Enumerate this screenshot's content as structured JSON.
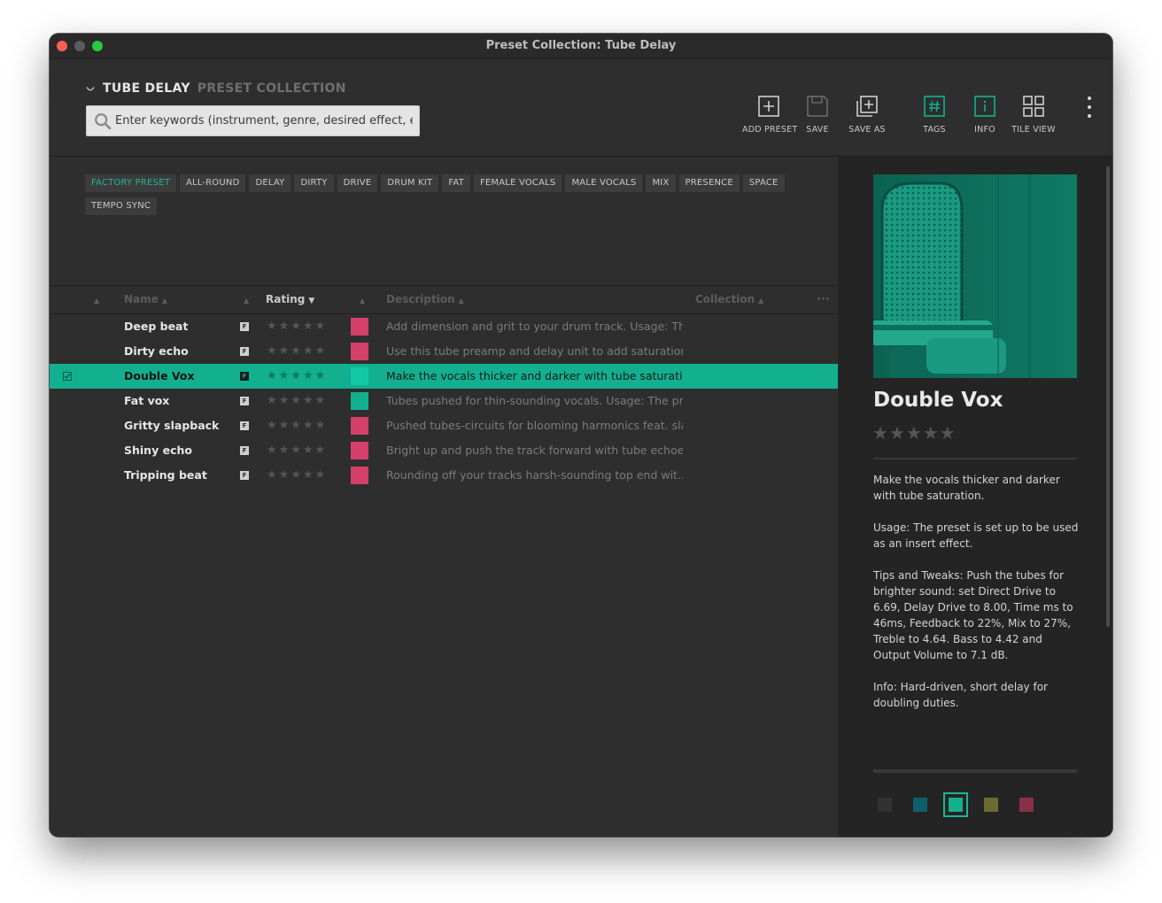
{
  "window": {
    "title": "Preset Collection: Tube Delay"
  },
  "header": {
    "brand_name": "TUBE DELAY",
    "brand_sub": "PRESET COLLECTION",
    "search_placeholder": "Enter keywords (instrument, genre, desired effect, etc.)"
  },
  "toolbar": {
    "add_preset": "ADD PRESET",
    "save": "SAVE",
    "save_as": "SAVE AS",
    "tags": "TAGS",
    "info": "INFO",
    "tile_view": "TILE VIEW"
  },
  "tags": [
    "FACTORY PRESET",
    "ALL-ROUND",
    "DELAY",
    "DIRTY",
    "DRIVE",
    "DRUM KIT",
    "FAT",
    "FEMALE VOCALS",
    "MALE VOCALS",
    "MIX",
    "PRESENCE",
    "SPACE",
    "TEMPO SYNC"
  ],
  "table": {
    "columns": {
      "name": "Name",
      "rating": "Rating",
      "description": "Description",
      "collection": "Collection"
    },
    "rows": [
      {
        "name": "Deep beat",
        "flag": "F",
        "rating": 0,
        "color": "#d4406a",
        "description": "Add dimension and grit to your drum track.  Usage: Th...",
        "selected": false
      },
      {
        "name": "Dirty echo",
        "flag": "F",
        "rating": 0,
        "color": "#d4406a",
        "description": "Use this tube preamp and delay unit to add saturation,...",
        "selected": false
      },
      {
        "name": "Double Vox",
        "flag": "F",
        "rating": 0,
        "color": "#12c9a6",
        "description": "Make the vocals thicker and darker with tube saturati...",
        "selected": true
      },
      {
        "name": "Fat vox",
        "flag": "F",
        "rating": 0,
        "color": "#12b08f",
        "description": "Tubes pushed for thin-sounding vocals.  Usage: The pr...",
        "selected": false
      },
      {
        "name": "Gritty slapback",
        "flag": "F",
        "rating": 0,
        "color": "#d4406a",
        "description": "Pushed tubes-circuits for blooming harmonics feat. sla...",
        "selected": false
      },
      {
        "name": "Shiny echo",
        "flag": "F",
        "rating": 0,
        "color": "#d4406a",
        "description": "Bright up and push the track forward with tube echoe...",
        "selected": false
      },
      {
        "name": "Tripping beat",
        "flag": "F",
        "rating": 0,
        "color": "#d4406a",
        "description": "Rounding off your tracks harsh-sounding top end wit...",
        "selected": false
      }
    ]
  },
  "detail": {
    "title": "Double Vox",
    "rating": 0,
    "paragraphs": [
      "Make the vocals thicker and darker with tube saturation.",
      "Usage: The preset is set up to be used as an insert effect.",
      "Tips and Tweaks: Push the tubes for brighter sound: set Direct Drive to 6.69, Delay Drive to 8.00, Time ms to 46ms, Feedback to 22%, Mix to 27%, Treble to 4.64. Bass to 4.42 and Output Volume to 7.1 dB.",
      "Info: Hard-driven, short delay for doubling duties."
    ],
    "color_options": [
      "#323232",
      "#0e5f6e",
      "#12b08f",
      "#6b6a32",
      "#8a2f48"
    ],
    "selected_color_index": 2
  },
  "colors": {
    "accent": "#12b08f",
    "pink": "#d4406a"
  }
}
